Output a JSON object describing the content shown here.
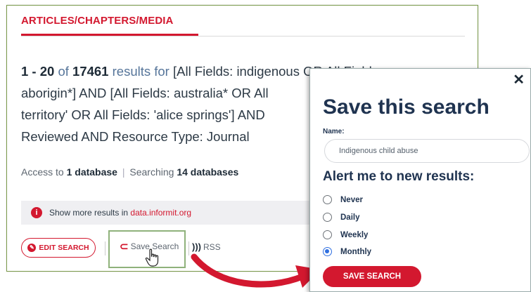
{
  "section_title": "ARTICLES/CHAPTERS/MEDIA",
  "results": {
    "range": "1 - 20",
    "of_label": "of",
    "total": "17461",
    "results_for_label": "results for",
    "query_lines": [
      "[All Fields: indigenous OR All Fields:",
      "aborigin*] AND [All Fields: australia* OR All",
      "territory' OR All Fields: 'alice springs'] AND",
      "Reviewed AND Resource Type: Journal"
    ]
  },
  "access": {
    "prefix": "Access to",
    "count": "1 database",
    "searching_label": "Searching",
    "searching_count": "14 databases"
  },
  "info_bar": {
    "text": "Show more results in",
    "link": "data.informit.org",
    "icon": "info-icon"
  },
  "actions": {
    "edit_search": "EDIT SEARCH",
    "save_search": "Save Search",
    "rss": "RSS"
  },
  "modal": {
    "close": "✕",
    "title": "Save this search",
    "name_label": "Name:",
    "name_value": "Indigenous child abuse",
    "alert_heading": "Alert me to new results:",
    "options": [
      "Never",
      "Daily",
      "Weekly",
      "Monthly"
    ],
    "selected_option": "Monthly",
    "save_button": "SAVE SEARCH"
  },
  "colors": {
    "accent": "#d3182f",
    "heading": "#1f3350",
    "radio_selected": "#2f6fe0",
    "highlight_border": "#8fb27b"
  }
}
